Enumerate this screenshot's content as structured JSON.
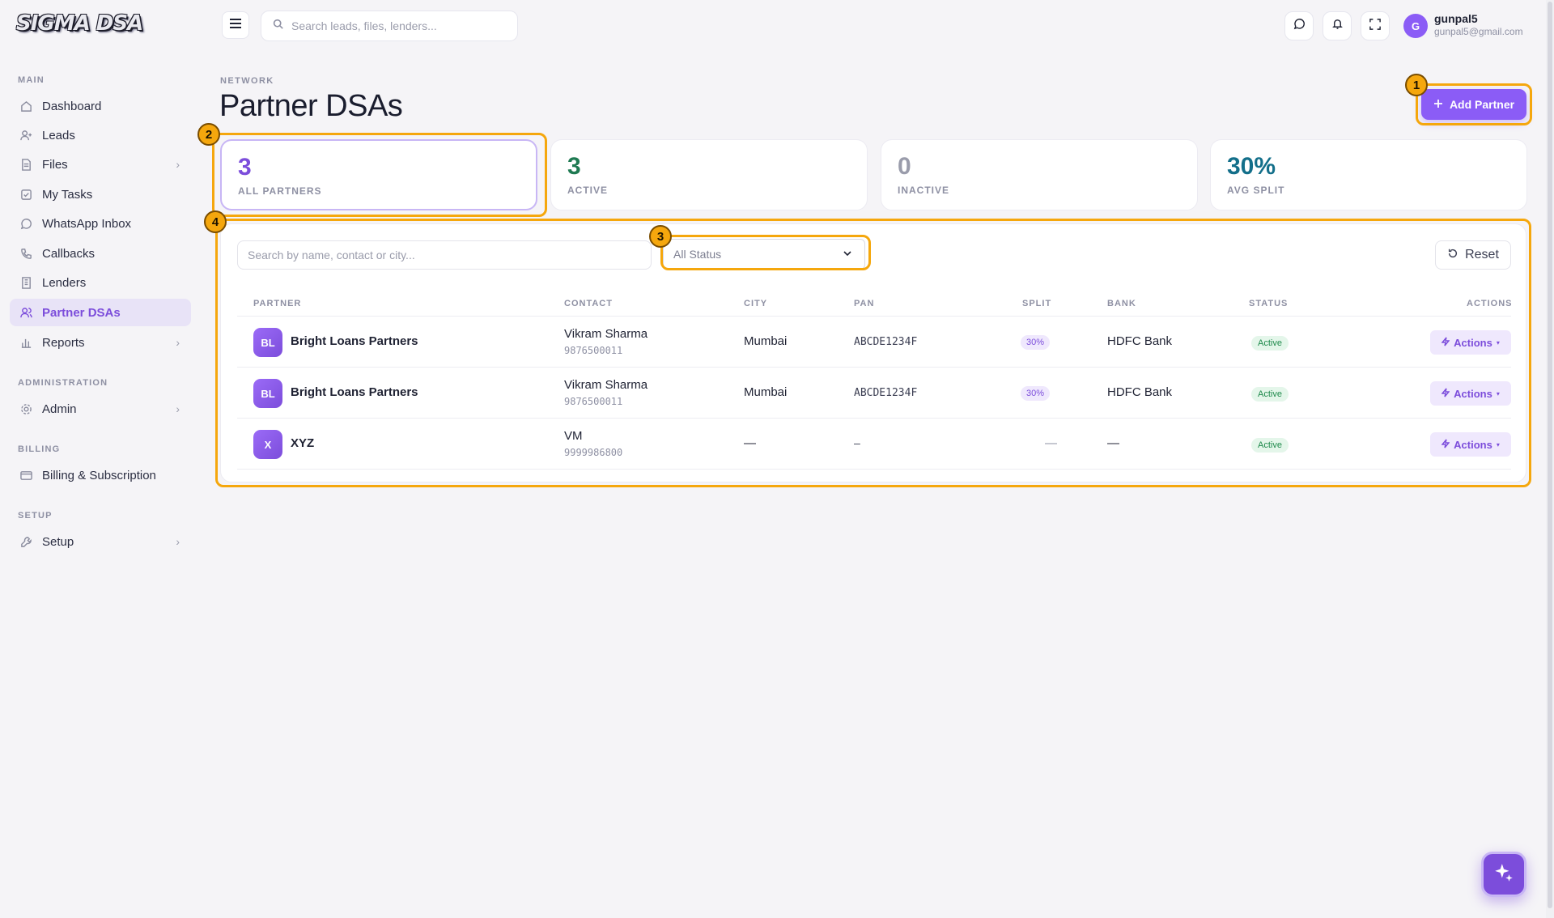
{
  "brand": {
    "logo_text": "SIGMA DSA"
  },
  "sidebar": {
    "sections": [
      {
        "title": "MAIN"
      },
      {
        "title": "ADMINISTRATION"
      },
      {
        "title": "BILLING"
      },
      {
        "title": "SETUP"
      }
    ],
    "items": [
      {
        "label": "Dashboard",
        "icon": "home-icon"
      },
      {
        "label": "Leads",
        "icon": "user-plus-icon"
      },
      {
        "label": "Files",
        "icon": "file-icon",
        "has_submenu": true
      },
      {
        "label": "My Tasks",
        "icon": "checkbox-icon"
      },
      {
        "label": "WhatsApp Inbox",
        "icon": "whatsapp-icon"
      },
      {
        "label": "Callbacks",
        "icon": "phone-icon"
      },
      {
        "label": "Lenders",
        "icon": "building-icon"
      },
      {
        "label": "Partner DSAs",
        "icon": "users-icon",
        "active": true
      },
      {
        "label": "Reports",
        "icon": "bar-chart-icon",
        "has_submenu": true
      },
      {
        "label": "Admin",
        "icon": "gear-icon",
        "has_submenu": true
      },
      {
        "label": "Billing & Subscription",
        "icon": "credit-card-icon"
      },
      {
        "label": "Setup",
        "icon": "wrench-icon",
        "has_submenu": true
      }
    ]
  },
  "topbar": {
    "search_placeholder": "Search leads, files, lenders...",
    "user": {
      "initial": "G",
      "name": "gunpal5",
      "email": "gunpal5@gmail.com"
    }
  },
  "header": {
    "breadcrumb": "NETWORK",
    "title": "Partner DSAs",
    "add_button_label": "Add Partner"
  },
  "stats": [
    {
      "value": "3",
      "label": "ALL PARTNERS",
      "color": "#7c4ddb"
    },
    {
      "value": "3",
      "label": "ACTIVE",
      "color": "#1f7a52"
    },
    {
      "value": "0",
      "label": "INACTIVE",
      "color": "#9a9cab"
    },
    {
      "value": "30%",
      "label": "AVG SPLIT",
      "color": "#136f8a"
    }
  ],
  "filters": {
    "search_placeholder": "Search by name, contact or city...",
    "status_value": "All Status",
    "reset_label": "Reset"
  },
  "table": {
    "columns": [
      "PARTNER",
      "CONTACT",
      "CITY",
      "PAN",
      "SPLIT",
      "BANK",
      "STATUS",
      "ACTIONS"
    ],
    "rows": [
      {
        "initials": "BL",
        "partner": "Bright Loans Partners",
        "contact_name": "Vikram Sharma",
        "contact_phone": "9876500011",
        "city": "Mumbai",
        "pan": "ABCDE1234F",
        "split": "30%",
        "bank": "HDFC Bank",
        "status": "Active",
        "action_label": "Actions"
      },
      {
        "initials": "BL",
        "partner": "Bright Loans Partners",
        "contact_name": "Vikram Sharma",
        "contact_phone": "9876500011",
        "city": "Mumbai",
        "pan": "ABCDE1234F",
        "split": "30%",
        "bank": "HDFC Bank",
        "status": "Active",
        "action_label": "Actions"
      },
      {
        "initials": "X",
        "partner": "XYZ",
        "contact_name": "VM",
        "contact_phone": "9999986800",
        "city": "—",
        "pan": "–",
        "split": "—",
        "bank": "—",
        "status": "Active",
        "action_label": "Actions"
      }
    ]
  },
  "annotations": [
    "1",
    "2",
    "3",
    "4"
  ],
  "colors": {
    "accent": "#8b5cf6",
    "highlight": "#f5a70d",
    "active_green": "#1f8a4c"
  }
}
